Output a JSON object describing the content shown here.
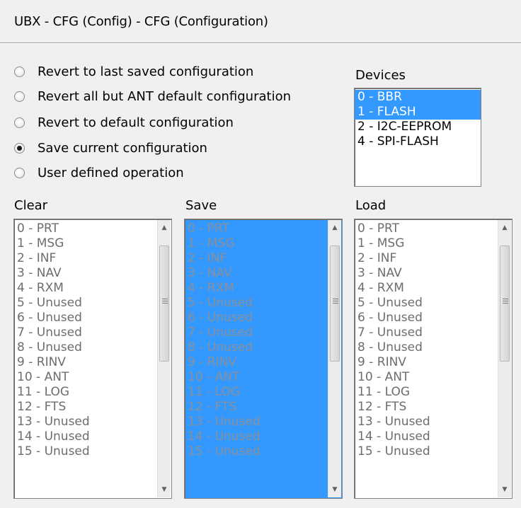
{
  "title": "UBX - CFG (Config) - CFG (Configuration)",
  "radios": [
    {
      "label": "Revert to last saved configuration",
      "checked": false
    },
    {
      "label": "Revert all but ANT default configuration",
      "checked": false
    },
    {
      "label": "Revert to default configuration",
      "checked": false
    },
    {
      "label": "Save current configuration",
      "checked": true
    },
    {
      "label": "User defined operation",
      "checked": false
    }
  ],
  "devices": {
    "label": "Devices",
    "items": [
      {
        "text": "0 - BBR",
        "selected": true
      },
      {
        "text": "1 - FLASH",
        "selected": true
      },
      {
        "text": "2 - I2C-EEPROM",
        "selected": false
      },
      {
        "text": "4 - SPI-FLASH",
        "selected": false
      }
    ]
  },
  "lists": {
    "clear": {
      "label": "Clear",
      "items": [
        "0 - PRT",
        "1 - MSG",
        "2 - INF",
        "3 - NAV",
        "4 - RXM",
        "5 - Unused",
        "6 - Unused",
        "7 - Unused",
        "8 - Unused",
        "9 - RINV",
        "10 - ANT",
        "11 - LOG",
        "12 - FTS",
        "13 - Unused",
        "14 - Unused",
        "15 - Unused"
      ]
    },
    "save": {
      "label": "Save",
      "all_selected": true,
      "items": [
        "0 - PRT",
        "1 - MSG",
        "2 - INF",
        "3 - NAV",
        "4 - RXM",
        "5 - Unused",
        "6 - Unused",
        "7 - Unused",
        "8 - Unused",
        "9 - RINV",
        "10 - ANT",
        "11 - LOG",
        "12 - FTS",
        "13 - Unused",
        "14 - Unused",
        "15 - Unused"
      ]
    },
    "load": {
      "label": "Load",
      "items": [
        "0 - PRT",
        "1 - MSG",
        "2 - INF",
        "3 - NAV",
        "4 - RXM",
        "5 - Unused",
        "6 - Unused",
        "7 - Unused",
        "8 - Unused",
        "9 - RINV",
        "10 - ANT",
        "11 - LOG",
        "12 - FTS",
        "13 - Unused",
        "14 - Unused",
        "15 - Unused"
      ]
    }
  },
  "colors": {
    "selection": "#3399ff",
    "disabled_text": "#6d6d6d"
  }
}
